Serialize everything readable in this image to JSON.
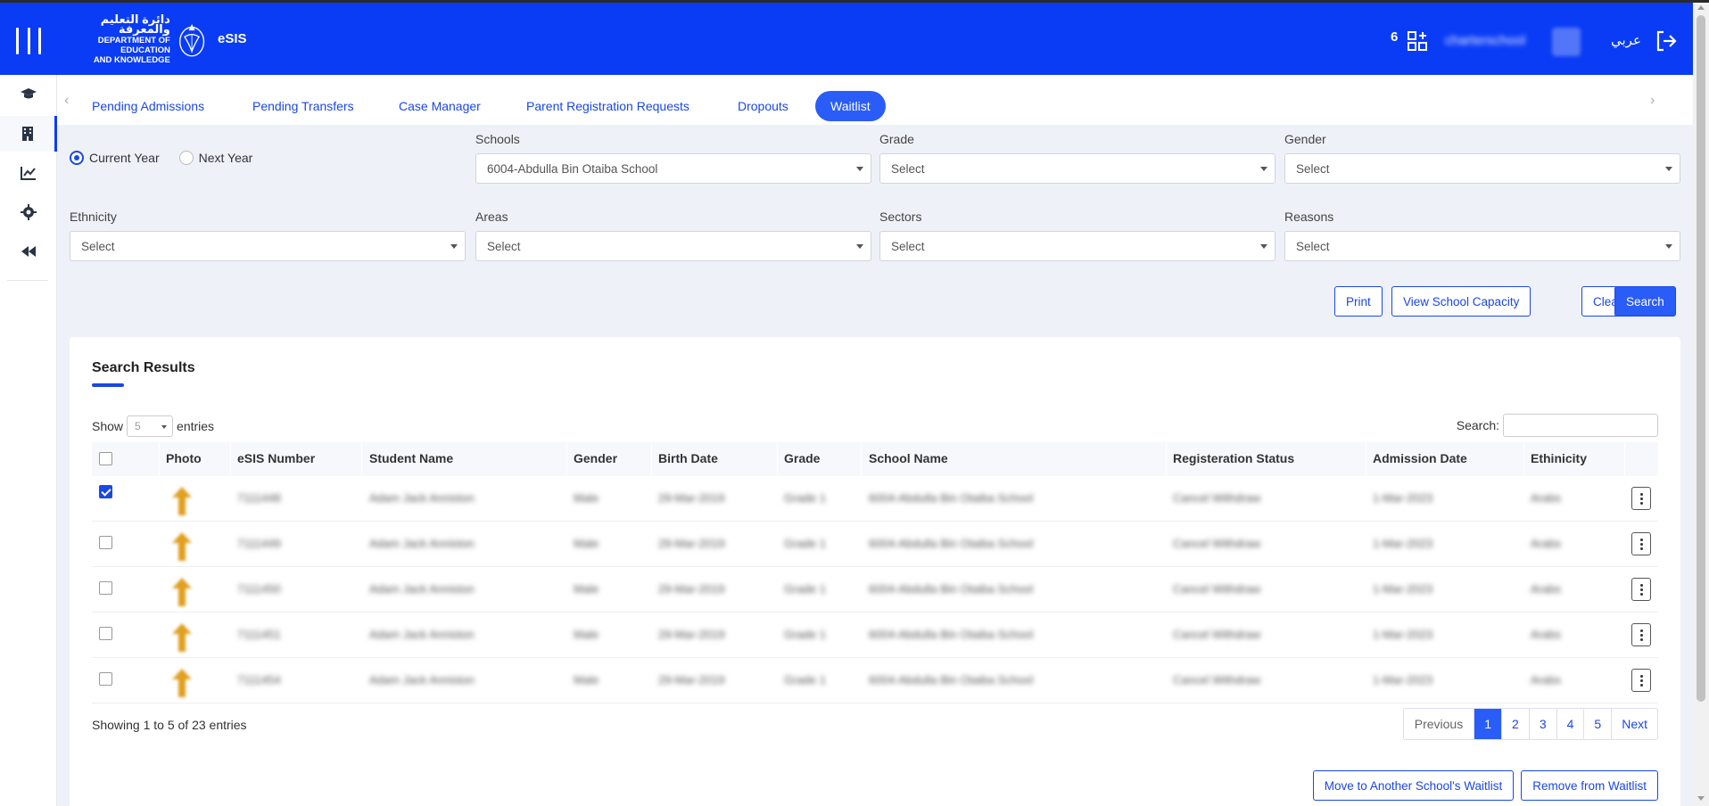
{
  "header": {
    "logo_arabic": "دائرة التعليم والمعرفة",
    "logo_line1": "DEPARTMENT OF EDUCATION",
    "logo_line2": "AND KNOWLEDGE",
    "brand": "eSIS",
    "notification_count": "6",
    "username": "charterschool",
    "language": "عربي"
  },
  "sidebar": {
    "items": [
      {
        "icon": "graduation-cap-icon"
      },
      {
        "icon": "building-icon",
        "active": true
      },
      {
        "icon": "chart-line-icon"
      },
      {
        "icon": "gear-icon"
      },
      {
        "icon": "rewind-icon"
      }
    ]
  },
  "tabs": [
    {
      "label": "Pending Admissions"
    },
    {
      "label": "Pending Transfers"
    },
    {
      "label": "Case Manager"
    },
    {
      "label": "Parent Registration Requests"
    },
    {
      "label": "Dropouts"
    },
    {
      "label": "Waitlist",
      "active": true
    }
  ],
  "filters": {
    "year_options": [
      "Current Year",
      "Next Year"
    ],
    "year_selected": "Current Year",
    "schools_label": "Schools",
    "schools_value": "6004-Abdulla Bin Otaiba School",
    "grade_label": "Grade",
    "grade_value": "Select",
    "gender_label": "Gender",
    "gender_value": "Select",
    "ethnicity_label": "Ethnicity",
    "ethnicity_value": "Select",
    "areas_label": "Areas",
    "areas_value": "Select",
    "sectors_label": "Sectors",
    "sectors_value": "Select",
    "reasons_label": "Reasons",
    "reasons_value": "Select"
  },
  "actions": {
    "print": "Print",
    "view_capacity": "View School Capacity",
    "clear": "Clear",
    "search": "Search"
  },
  "results": {
    "title": "Search Results",
    "show_label": "Show",
    "show_value": "5",
    "entries_label": "entries",
    "search_label": "Search:",
    "columns": [
      "Photo",
      "eSIS Number",
      "Student Name",
      "Gender",
      "Birth Date",
      "Grade",
      "School Name",
      "Registeration Status",
      "Admission Date",
      "Ethinicity"
    ],
    "rows": [
      {
        "checked": true,
        "esis": "7111448",
        "name": "Adam Jack Anniston",
        "gender": "Male",
        "birth": "29-Mar-2019",
        "grade": "Grade 1",
        "school": "6004-Abdulla Bin Otaiba School",
        "status": "Cancel Withdraw",
        "admission": "1-Mar-2023",
        "ethnicity": "Arabs"
      },
      {
        "checked": false,
        "esis": "7111449",
        "name": "Adam Jack Anniston",
        "gender": "Male",
        "birth": "29-Mar-2019",
        "grade": "Grade 1",
        "school": "6004-Abdulla Bin Otaiba School",
        "status": "Cancel Withdraw",
        "admission": "1-Mar-2023",
        "ethnicity": "Arabs"
      },
      {
        "checked": false,
        "esis": "7111450",
        "name": "Adam Jack Anniston",
        "gender": "Male",
        "birth": "29-Mar-2019",
        "grade": "Grade 1",
        "school": "6004-Abdulla Bin Otaiba School",
        "status": "Cancel Withdraw",
        "admission": "1-Mar-2023",
        "ethnicity": "Arabs"
      },
      {
        "checked": false,
        "esis": "7111451",
        "name": "Adam Jack Anniston",
        "gender": "Male",
        "birth": "29-Mar-2019",
        "grade": "Grade 1",
        "school": "6004-Abdulla Bin Otaiba School",
        "status": "Cancel Withdraw",
        "admission": "1-Mar-2023",
        "ethnicity": "Arabs"
      },
      {
        "checked": false,
        "esis": "7111454",
        "name": "Adam Jack Anniston",
        "gender": "Male",
        "birth": "29-Mar-2019",
        "grade": "Grade 1",
        "school": "6004-Abdulla Bin Otaiba School",
        "status": "Cancel Withdraw",
        "admission": "1-Mar-2023",
        "ethnicity": "Arabs"
      }
    ],
    "showing_text": "Showing 1 to 5 of 23 entries",
    "pagination": [
      "Previous",
      "1",
      "2",
      "3",
      "4",
      "5",
      "Next"
    ],
    "current_page": "1",
    "move_button": "Move to Another School's Waitlist",
    "remove_button": "Remove from Waitlist"
  },
  "colors": {
    "primary": "#0a3cf5",
    "accent": "#2a5cf8",
    "background": "#eef1f7"
  }
}
